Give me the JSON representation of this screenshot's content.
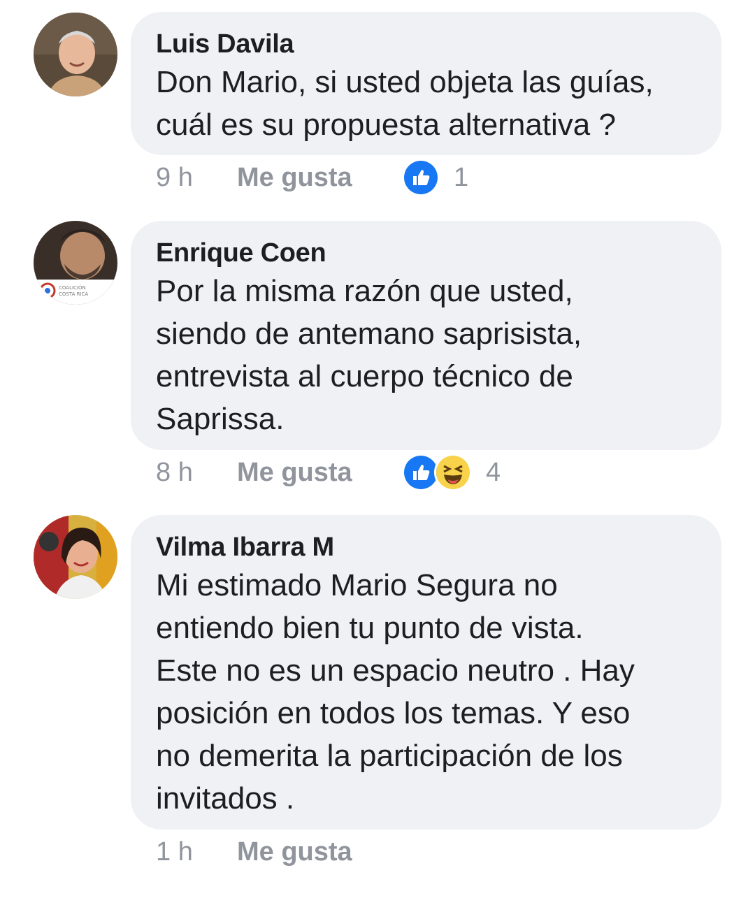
{
  "comments": [
    {
      "author": "Luis Davila",
      "text": "Don Mario, si usted objeta las guías,\ncuál es su propuesta alternativa ?",
      "time": "9 h",
      "like_label": "Me gusta",
      "reactions": [
        "like"
      ],
      "reaction_count": "1"
    },
    {
      "author": "Enrique Coen",
      "text": "Por la misma razón que usted,\nsiendo de antemano saprisista,\nentrevista al cuerpo técnico de\nSaprissa.",
      "time": "8 h",
      "like_label": "Me gusta",
      "reactions": [
        "like",
        "haha"
      ],
      "reaction_count": "4",
      "avatar_badge": "COALICIÓN COSTA RICA"
    },
    {
      "author": "Vilma Ibarra M",
      "text": "Mi estimado Mario Segura no\nentiendo bien  tu punto de vista.\nEste no es un espacio neutro . Hay\nposición en todos los temas. Y eso\nno demerita la participación de los\ninvitados .",
      "time": "1 h",
      "like_label": "Me gusta"
    }
  ],
  "colors": {
    "bubble": "#f0f1f4",
    "meta_text": "#90949c",
    "like_blue": "#1877f2",
    "haha_yellow": "#f7d24a"
  }
}
